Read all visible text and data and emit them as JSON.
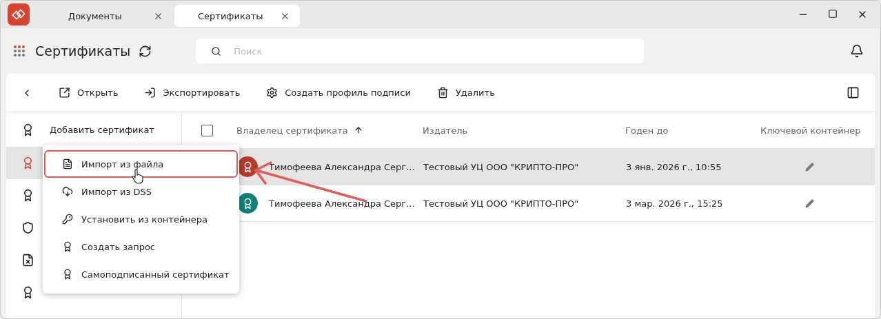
{
  "tabs": [
    {
      "label": "Документы",
      "selected": false
    },
    {
      "label": "Сертификаты",
      "selected": true
    }
  ],
  "header": {
    "title": "Сертификаты",
    "search": {
      "placeholder": "Поиск"
    }
  },
  "toolbar": [
    "Открыть",
    "Экспортировать",
    "Создать профиль подписи",
    "Удалить"
  ],
  "sidebar": {
    "items": [
      {
        "label": "Добавить сертификат",
        "selected": false
      },
      {
        "selected": true
      },
      {
        "selected": false
      },
      {
        "selected": false
      },
      {
        "selected": false
      },
      {
        "selected": false
      }
    ]
  },
  "table": {
    "select_all": {
      "checked": false
    },
    "columns": [
      "Владелец сертификата",
      "Издатель",
      "Годен до",
      "Ключевой контейнер"
    ],
    "rows": [
      {
        "owner": "Тимофеева Александра Серг...",
        "issuer": "Тестовый УЦ ООО \"КРИПТО-ПРО\"",
        "expires": "3 янв. 2026 г., 10:55",
        "color": "#b63b2b",
        "selected": true
      },
      {
        "owner": "Тимофеева Александра Серг...",
        "issuer": "Тестовый УЦ ООО \"КРИПТО-ПРО\"",
        "expires": "3 мар. 2026 г., 15:25",
        "color": "#14807a",
        "selected": false
      }
    ]
  },
  "menu": {
    "items": [
      {
        "label": "Импорт из файла",
        "selected": true
      },
      {
        "label": "Импорт из DSS",
        "selected": false
      },
      {
        "label": "Установить из контейнера",
        "selected": false
      },
      {
        "label": "Создать запрос",
        "selected": false
      },
      {
        "label": "Самоподписанный сертификат",
        "selected": false
      }
    ]
  }
}
